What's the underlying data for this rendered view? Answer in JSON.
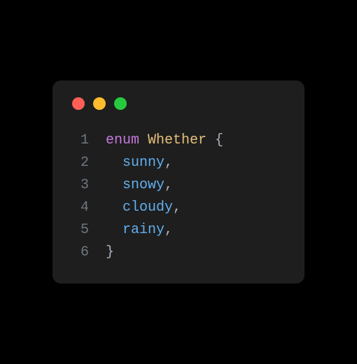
{
  "code": {
    "keyword": "enum",
    "typename": "Whether",
    "open_brace": "{",
    "close_brace": "}",
    "comma": ",",
    "members": {
      "m1": "sunny",
      "m2": "snowy",
      "m3": "cloudy",
      "m4": "rainy"
    },
    "line_numbers": {
      "l1": "1",
      "l2": "2",
      "l3": "3",
      "l4": "4",
      "l5": "5",
      "l6": "6"
    }
  },
  "colors": {
    "background": "#000000",
    "editor_bg": "#1e1e1e",
    "red": "#ff5f56",
    "yellow": "#ffbd2e",
    "green": "#27c93f",
    "line_number": "#6e7681",
    "keyword": "#c678dd",
    "typename": "#e5c07b",
    "member": "#61afef",
    "default": "#abb2bf"
  }
}
